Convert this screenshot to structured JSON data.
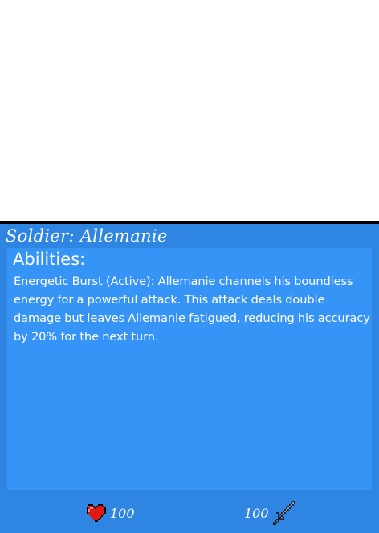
{
  "card": {
    "title": "Soldier: Allemanie",
    "abilities_heading": "Abilities:",
    "ability_text": "Energetic Burst (Active): Allemanie channels his boundless energy for a powerful attack. This attack deals double damage but leaves Allemanie fatigued, reducing his accuracy by 20% for the next turn.",
    "stats": {
      "health": {
        "value": "100",
        "icon": "heart-icon"
      },
      "attack": {
        "value": "100",
        "icon": "sword-icon"
      }
    }
  },
  "colors": {
    "card_background": "#2f86e2",
    "panel_background": "#3694f7",
    "heart": "#e01818",
    "text": "#ffffff"
  }
}
